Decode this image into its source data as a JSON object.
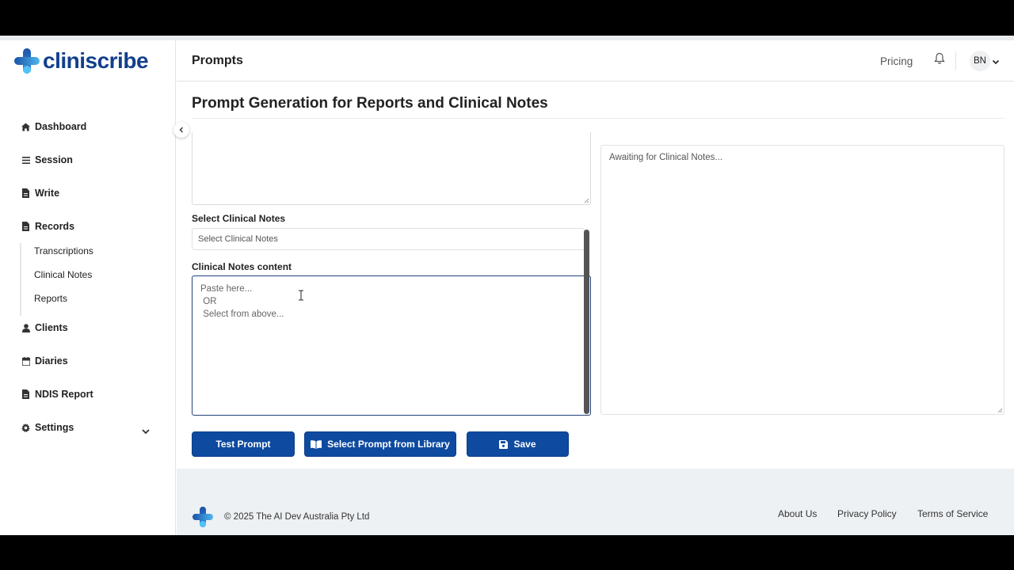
{
  "app": {
    "brand": "cliniscribe"
  },
  "header": {
    "page_title": "Prompts",
    "pricing": "Pricing",
    "avatar_initials": "BN"
  },
  "sidebar": {
    "items": [
      {
        "label": "Dashboard",
        "icon": "home-icon"
      },
      {
        "label": "Session",
        "icon": "menu-icon"
      },
      {
        "label": "Write",
        "icon": "file-icon"
      },
      {
        "label": "Records",
        "icon": "file-icon"
      },
      {
        "label": "Clients",
        "icon": "user-icon"
      },
      {
        "label": "Diaries",
        "icon": "calendar-icon"
      },
      {
        "label": "NDIS Report",
        "icon": "file-icon"
      },
      {
        "label": "Settings",
        "icon": "gear-icon"
      }
    ],
    "records_sub": [
      "Transcriptions",
      "Clinical Notes",
      "Reports"
    ]
  },
  "main": {
    "heading": "Prompt Generation for Reports and Clinical Notes",
    "select_label": "Select Clinical Notes",
    "select_value": "Select Clinical Notes",
    "content_label": "Clinical Notes content",
    "content_placeholder": "Paste here...\n OR\n Select from above...",
    "output_placeholder": "Awaiting for Clinical Notes...",
    "buttons": {
      "test": "Test Prompt",
      "library": "Select Prompt from Library",
      "save": "Save"
    }
  },
  "footer": {
    "copyright": "© 2025 The AI Dev Australia Pty Ltd",
    "links": [
      "About Us",
      "Privacy Policy",
      "Terms of Service"
    ]
  }
}
